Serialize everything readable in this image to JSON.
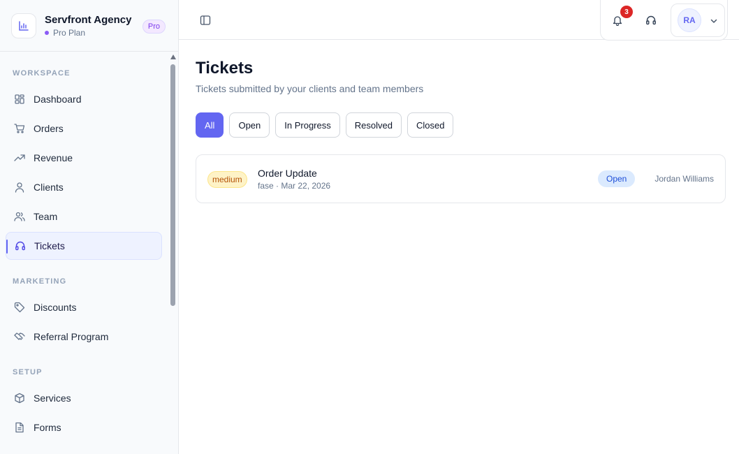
{
  "brand": {
    "name": "Servfront Agency",
    "plan": "Pro Plan",
    "badge": "Pro"
  },
  "sidebar": {
    "sections": [
      {
        "title": "WORKSPACE",
        "items": [
          {
            "label": "Dashboard",
            "icon": "grid-icon"
          },
          {
            "label": "Orders",
            "icon": "cart-icon"
          },
          {
            "label": "Revenue",
            "icon": "trending-up-icon"
          },
          {
            "label": "Clients",
            "icon": "user-icon"
          },
          {
            "label": "Team",
            "icon": "users-icon"
          },
          {
            "label": "Tickets",
            "icon": "headset-icon",
            "active": true
          }
        ]
      },
      {
        "title": "MARKETING",
        "items": [
          {
            "label": "Discounts",
            "icon": "tag-icon"
          },
          {
            "label": "Referral Program",
            "icon": "handshake-icon"
          }
        ]
      },
      {
        "title": "SETUP",
        "items": [
          {
            "label": "Services",
            "icon": "box-icon"
          },
          {
            "label": "Forms",
            "icon": "file-text-icon"
          }
        ]
      }
    ]
  },
  "header": {
    "notifications_count": "3",
    "avatar_initials": "RA"
  },
  "page": {
    "title": "Tickets",
    "subtitle": "Tickets submitted by your clients and team members",
    "filters": [
      {
        "label": "All",
        "active": true
      },
      {
        "label": "Open"
      },
      {
        "label": "In Progress"
      },
      {
        "label": "Resolved"
      },
      {
        "label": "Closed"
      }
    ],
    "tickets": [
      {
        "priority": "medium",
        "title": "Order Update",
        "meta": "fase · Mar 22, 2026",
        "status": "Open",
        "assignee": "Jordan Williams"
      }
    ]
  },
  "colors": {
    "accent": "#6366f1",
    "badge_red": "#dc2626",
    "priority_medium": "#fef3c7",
    "status_open": "#dbeafe"
  }
}
